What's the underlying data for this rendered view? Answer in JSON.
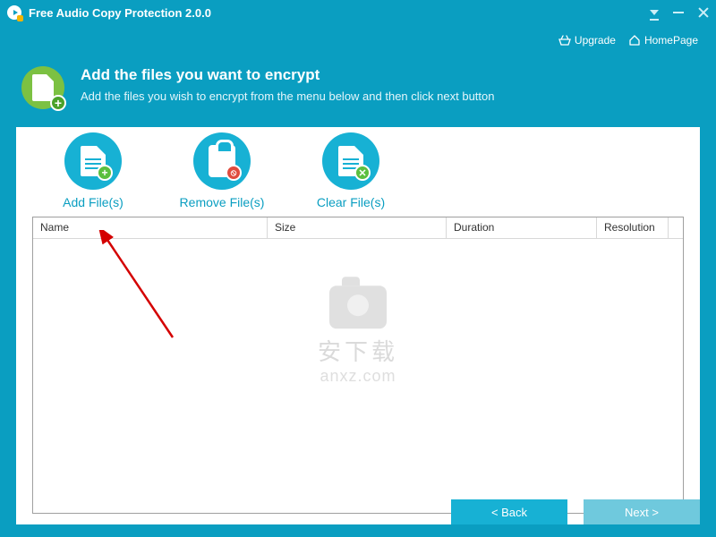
{
  "app": {
    "title": "Free Audio Copy Protection 2.0.0"
  },
  "links": {
    "upgrade": "Upgrade",
    "homepage": "HomePage"
  },
  "header": {
    "title": "Add the files you want to encrypt",
    "subtitle": "Add the files you wish to encrypt from the menu below and then click next button"
  },
  "actions": {
    "add": "Add File(s)",
    "remove": "Remove File(s)",
    "clear": "Clear File(s)"
  },
  "table": {
    "columns": {
      "name": "Name",
      "size": "Size",
      "duration": "Duration",
      "resolution": "Resolution"
    },
    "rows": []
  },
  "nav": {
    "back": "<  Back",
    "next": "Next  >"
  },
  "watermark": {
    "line1": "安下载",
    "line2": "anxz.com"
  },
  "colors": {
    "primary": "#0a9ec1",
    "accent": "#17b1d4",
    "green": "#7cc142"
  }
}
